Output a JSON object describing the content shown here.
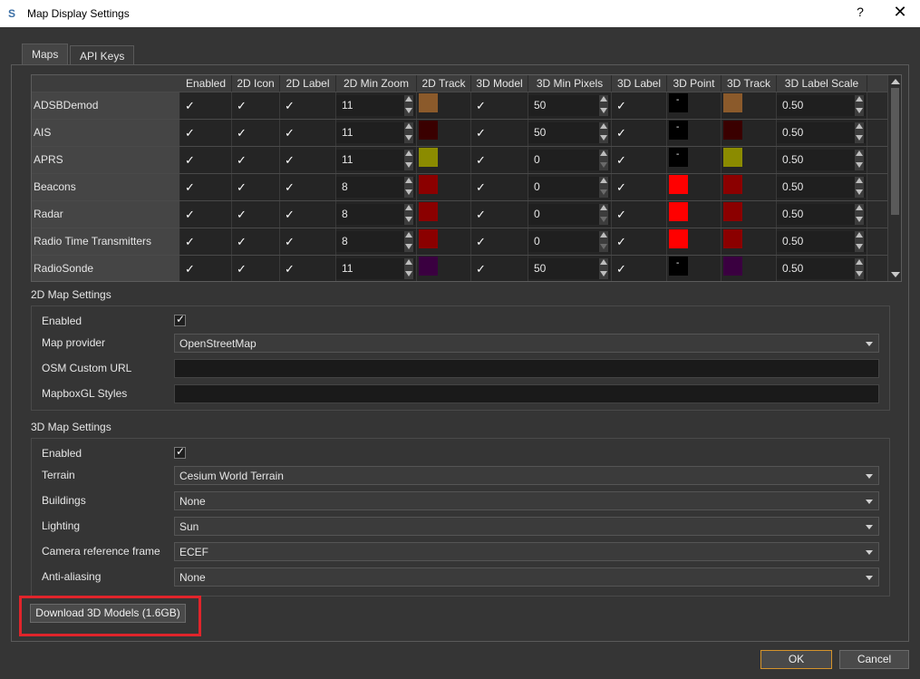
{
  "window": {
    "title": "Map Display Settings",
    "logo": "S",
    "help_glyph": "?",
    "close_glyph": "✕"
  },
  "tabs": [
    {
      "label": "Maps"
    },
    {
      "label": "API Keys"
    }
  ],
  "table": {
    "columns": [
      "Enabled",
      "2D Icon",
      "2D Label",
      "2D Min Zoom",
      "2D Track",
      "3D Model",
      "3D Min Pixels",
      "3D Label",
      "3D Point",
      "3D Track",
      "3D Label Scale"
    ],
    "rows": [
      {
        "name": "ADSBDemod",
        "enabled": true,
        "icon2d": true,
        "label2d": true,
        "min_zoom": "11",
        "track2d": "#8b5a2b",
        "model3d": true,
        "min_pixels": "50",
        "label3d": true,
        "point3d": "#000000",
        "point3d_text": "-",
        "track3d": "#8b5a2b",
        "label_scale": "0.50"
      },
      {
        "name": "AIS",
        "enabled": true,
        "icon2d": true,
        "label2d": true,
        "min_zoom": "11",
        "track2d": "#3a0000",
        "model3d": true,
        "min_pixels": "50",
        "label3d": true,
        "point3d": "#000000",
        "point3d_text": "-",
        "track3d": "#3a0000",
        "label_scale": "0.50"
      },
      {
        "name": "APRS",
        "enabled": true,
        "icon2d": true,
        "label2d": true,
        "min_zoom": "11",
        "track2d": "#8b8b00",
        "model3d": true,
        "min_pixels": "0",
        "label3d": true,
        "point3d": "#000000",
        "point3d_text": "-",
        "track3d": "#8b8b00",
        "label_scale": "0.50"
      },
      {
        "name": "Beacons",
        "enabled": true,
        "icon2d": true,
        "label2d": true,
        "min_zoom": "8",
        "track2d": "#8b0000",
        "model3d": true,
        "min_pixels": "0",
        "label3d": true,
        "point3d": "#ff0000",
        "point3d_text": "",
        "track3d": "#8b0000",
        "label_scale": "0.50"
      },
      {
        "name": "Radar",
        "enabled": true,
        "icon2d": true,
        "label2d": true,
        "min_zoom": "8",
        "track2d": "#8b0000",
        "model3d": true,
        "min_pixels": "0",
        "label3d": true,
        "point3d": "#ff0000",
        "point3d_text": "",
        "track3d": "#8b0000",
        "label_scale": "0.50"
      },
      {
        "name": "Radio Time Transmitters",
        "enabled": true,
        "icon2d": true,
        "label2d": true,
        "min_zoom": "8",
        "track2d": "#8b0000",
        "model3d": true,
        "min_pixels": "0",
        "label3d": true,
        "point3d": "#ff0000",
        "point3d_text": "",
        "track3d": "#8b0000",
        "label_scale": "0.50"
      },
      {
        "name": "RadioSonde",
        "enabled": true,
        "icon2d": true,
        "label2d": true,
        "min_zoom": "11",
        "track2d": "#3a0040",
        "model3d": true,
        "min_pixels": "50",
        "label3d": true,
        "point3d": "#000000",
        "point3d_text": "-",
        "track3d": "#3a0040",
        "label_scale": "0.50"
      }
    ]
  },
  "settings2d": {
    "title": "2D Map Settings",
    "enabled_label": "Enabled",
    "enabled": true,
    "map_provider_label": "Map provider",
    "map_provider": "OpenStreetMap",
    "osm_url_label": "OSM Custom URL",
    "osm_url": "",
    "mapbox_label": "MapboxGL Styles",
    "mapbox": ""
  },
  "settings3d": {
    "title": "3D Map Settings",
    "enabled_label": "Enabled",
    "enabled": true,
    "terrain_label": "Terrain",
    "terrain": "Cesium World Terrain",
    "buildings_label": "Buildings",
    "buildings": "None",
    "lighting_label": "Lighting",
    "lighting": "Sun",
    "camera_label": "Camera reference frame",
    "camera": "ECEF",
    "antialias_label": "Anti-aliasing",
    "antialias": "None"
  },
  "buttons": {
    "download": "Download 3D Models (1.6GB)",
    "ok": "OK",
    "cancel": "Cancel"
  },
  "colors": {
    "highlight": "#e0242b",
    "ok_border": "#d4932b",
    "checkmark": "✓"
  }
}
